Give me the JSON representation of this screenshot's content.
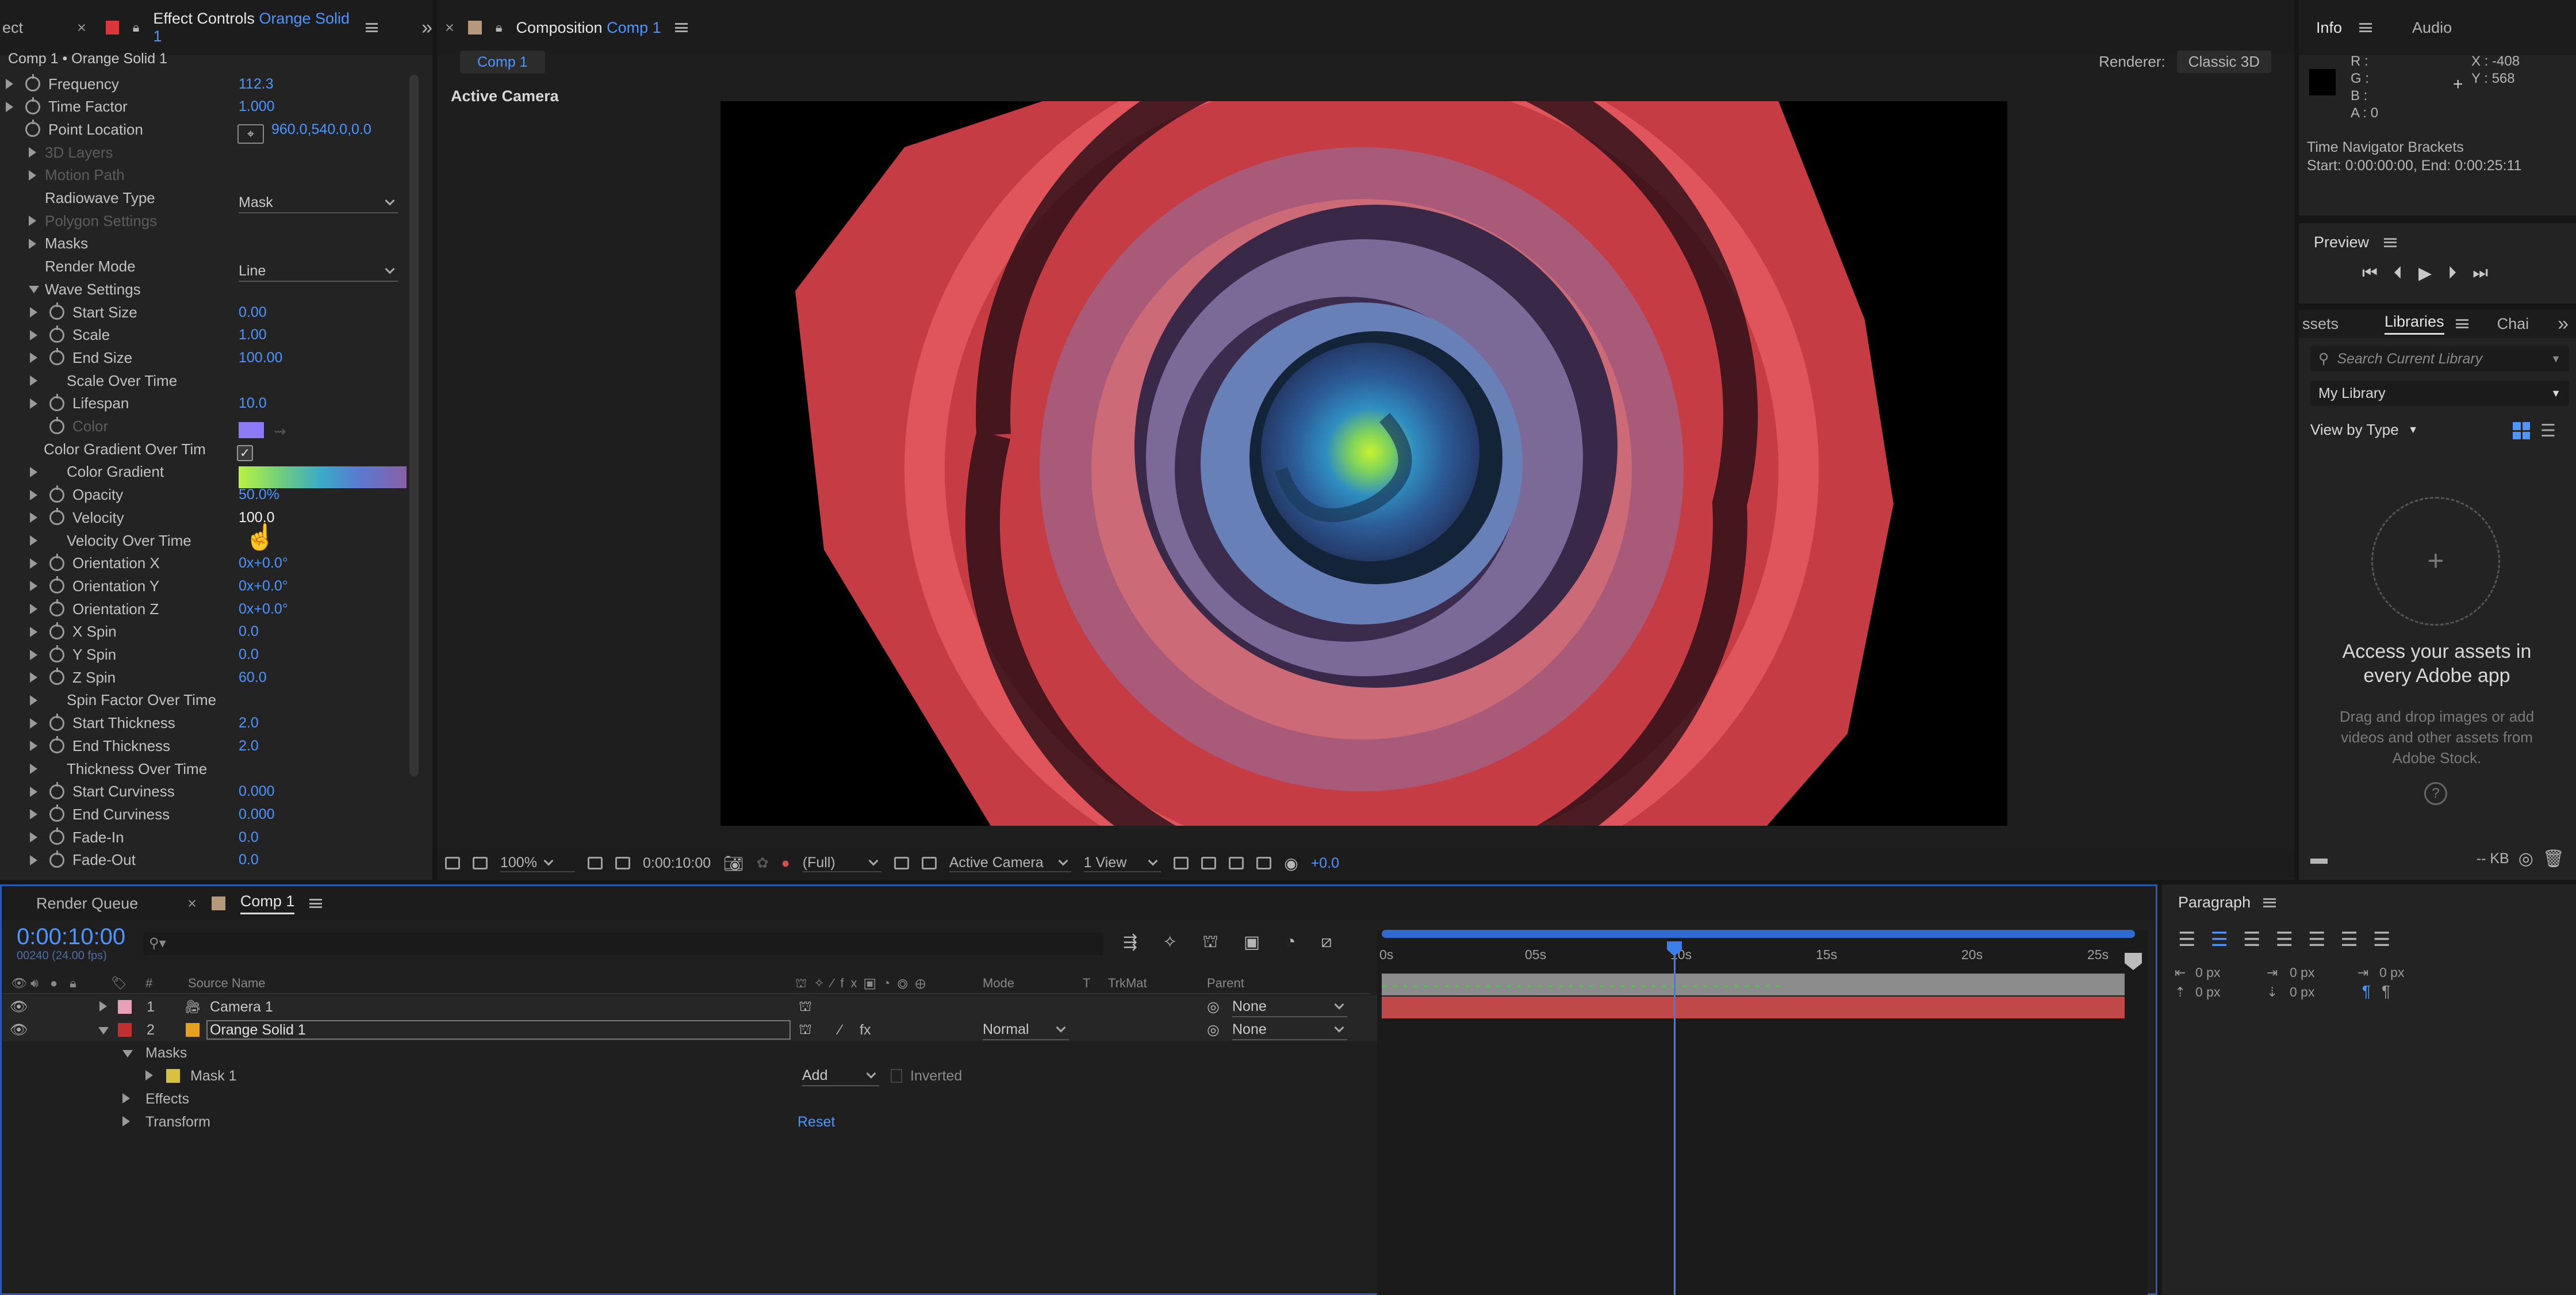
{
  "effect_controls": {
    "tab_left": "ect",
    "tab_title": "Effect Controls",
    "tab_layer": "Orange Solid 1",
    "breadcrumb": "Comp 1 • Orange Solid 1",
    "properties": [
      {
        "label": "Frequency",
        "value": "112.3",
        "indent": 1,
        "expand": "right",
        "stopwatch": true,
        "dim": false
      },
      {
        "label": "Time Factor",
        "value": "1.000",
        "indent": 1,
        "expand": "right",
        "stopwatch": true,
        "dim": false
      },
      {
        "label": "Point Location",
        "value": "960.0,540.0,0.0",
        "indent": 1,
        "expand": "none",
        "stopwatch": true,
        "dim": false
      },
      {
        "label": "3D Layers",
        "value": "",
        "indent": 0,
        "expand": "right",
        "stopwatch": false,
        "dim": true
      },
      {
        "label": "Motion Path",
        "value": "",
        "indent": 0,
        "expand": "right",
        "stopwatch": false,
        "dim": true
      },
      {
        "label": "Radiowave Type",
        "value": "",
        "indent": 0,
        "expand": "none",
        "stopwatch": false,
        "dim": false
      },
      {
        "label": "Polygon Settings",
        "value": "",
        "indent": 0,
        "expand": "right",
        "stopwatch": false,
        "dim": true
      },
      {
        "label": "Masks",
        "value": "",
        "indent": 0,
        "expand": "right",
        "stopwatch": false,
        "dim": false
      },
      {
        "label": "Render Mode",
        "value": "",
        "indent": 0,
        "expand": "none",
        "stopwatch": false,
        "dim": false
      },
      {
        "label": "Wave Settings",
        "value": "",
        "indent": 0,
        "expand": "down",
        "stopwatch": false,
        "dim": false
      },
      {
        "label": "Start Size",
        "value": "0.00",
        "indent": 2,
        "expand": "right",
        "stopwatch": true,
        "dim": false
      },
      {
        "label": "Scale",
        "value": "1.00",
        "indent": 2,
        "expand": "right",
        "stopwatch": true,
        "dim": false
      },
      {
        "label": "End Size",
        "value": "100.00",
        "indent": 2,
        "expand": "right",
        "stopwatch": true,
        "dim": false
      },
      {
        "label": "Scale Over Time",
        "value": "",
        "indent": 2,
        "expand": "right",
        "stopwatch": false,
        "dim": false
      },
      {
        "label": "Lifespan",
        "value": "10.0",
        "indent": 2,
        "expand": "right",
        "stopwatch": true,
        "dim": false
      },
      {
        "label": "Color",
        "value": "",
        "indent": 2,
        "expand": "none",
        "stopwatch": true,
        "dim": true
      },
      {
        "label": "Color Gradient Over Tim",
        "value": "",
        "indent": 2,
        "expand": "none",
        "stopwatch": false,
        "dim": false
      },
      {
        "label": "Color Gradient",
        "value": "",
        "indent": 2,
        "expand": "right",
        "stopwatch": false,
        "dim": false
      },
      {
        "label": "Opacity",
        "value": "50.0%",
        "indent": 2,
        "expand": "right",
        "stopwatch": true,
        "dim": false
      },
      {
        "label": "Velocity",
        "value": "100.0",
        "indent": 2,
        "expand": "right",
        "stopwatch": true,
        "dim": false
      },
      {
        "label": "Velocity Over Time",
        "value": "",
        "indent": 2,
        "expand": "right",
        "stopwatch": false,
        "dim": false
      },
      {
        "label": "Orientation X",
        "value": "0x+0.0°",
        "indent": 2,
        "expand": "right",
        "stopwatch": true,
        "dim": false
      },
      {
        "label": "Orientation Y",
        "value": "0x+0.0°",
        "indent": 2,
        "expand": "right",
        "stopwatch": true,
        "dim": false
      },
      {
        "label": "Orientation Z",
        "value": "0x+0.0°",
        "indent": 2,
        "expand": "right",
        "stopwatch": true,
        "dim": false
      },
      {
        "label": "X Spin",
        "value": "0.0",
        "indent": 2,
        "expand": "right",
        "stopwatch": true,
        "dim": false
      },
      {
        "label": "Y Spin",
        "value": "0.0",
        "indent": 2,
        "expand": "right",
        "stopwatch": true,
        "dim": false
      },
      {
        "label": "Z Spin",
        "value": "60.0",
        "indent": 2,
        "expand": "right",
        "stopwatch": true,
        "dim": false
      },
      {
        "label": "Spin Factor Over Time",
        "value": "",
        "indent": 2,
        "expand": "right",
        "stopwatch": false,
        "dim": false
      },
      {
        "label": "Start Thickness",
        "value": "2.0",
        "indent": 2,
        "expand": "right",
        "stopwatch": true,
        "dim": false
      },
      {
        "label": "End Thickness",
        "value": "2.0",
        "indent": 2,
        "expand": "right",
        "stopwatch": true,
        "dim": false
      },
      {
        "label": "Thickness Over Time",
        "value": "",
        "indent": 2,
        "expand": "right",
        "stopwatch": false,
        "dim": false
      },
      {
        "label": "Start Curviness",
        "value": "0.000",
        "indent": 2,
        "expand": "right",
        "stopwatch": true,
        "dim": false
      },
      {
        "label": "End Curviness",
        "value": "0.000",
        "indent": 2,
        "expand": "right",
        "stopwatch": true,
        "dim": false
      },
      {
        "label": "Fade-In",
        "value": "0.0",
        "indent": 2,
        "expand": "right",
        "stopwatch": true,
        "dim": false
      },
      {
        "label": "Fade-Out",
        "value": "0.0",
        "indent": 2,
        "expand": "right",
        "stopwatch": true,
        "dim": false
      }
    ],
    "radiowave_type": "Mask",
    "render_mode": "Line",
    "color_gradient_over_time_checked": true
  },
  "composition": {
    "tab_title": "Composition",
    "tab_comp": "Comp 1",
    "sub_tab": "Comp 1",
    "renderer_label": "Renderer:",
    "renderer_value": "Classic 3D",
    "camera_label": "Active Camera",
    "toolbar": {
      "zoom": "100%",
      "timecode": "0:00:10:00",
      "resolution": "(Full)",
      "camera": "Active Camera",
      "views": "1 View",
      "exposure": "+0.0"
    }
  },
  "info": {
    "tab_info": "Info",
    "tab_audio": "Audio",
    "r": "R :",
    "g": "G :",
    "b": "B :",
    "a": "A :  0",
    "x": "X : -408",
    "y": "Y : 568",
    "bracket_title": "Time Navigator Brackets",
    "bracket_range": "Start: 0:00:00:00, End: 0:00:25:11"
  },
  "preview": {
    "title": "Preview"
  },
  "libraries": {
    "tab_left": "ssets",
    "tab_active": "Libraries",
    "tab_right": "Chai",
    "search_placeholder": "Search Current Library",
    "library": "My Library",
    "view_by": "View by Type",
    "headline": "Access your assets in every Adobe app",
    "sub": "Drag and drop images or add videos and other assets from Adobe Stock.",
    "size": "-- KB"
  },
  "timeline": {
    "tab_render_queue": "Render Queue",
    "tab_comp": "Comp 1",
    "timecode": "0:00:10:00",
    "frames": "00240 (24.00 fps)",
    "col_num": "#",
    "col_source": "Source Name",
    "col_mode": "Mode",
    "col_t": "T",
    "col_trkmat": "TrkMat",
    "col_parent": "Parent",
    "ruler": [
      "0s",
      "05s",
      "10s",
      "15s",
      "20s",
      "25s"
    ],
    "playhead_fraction": 0.4,
    "layers": [
      {
        "num": "1",
        "name": "Camera 1",
        "color": "#e8a0b8",
        "mode": "",
        "parent": "None"
      },
      {
        "num": "2",
        "name": "Orange Solid 1",
        "color": "#c03030",
        "mode": "Normal",
        "parent": "None"
      }
    ],
    "masks_label": "Masks",
    "mask1": "Mask 1",
    "mask_mode": "Add",
    "inverted": "Inverted",
    "effects": "Effects",
    "transform": "Transform",
    "reset": "Reset"
  },
  "paragraph": {
    "title": "Paragraph",
    "px": [
      "0 px",
      "0 px",
      "0 px",
      "0 px",
      "0 px"
    ]
  }
}
